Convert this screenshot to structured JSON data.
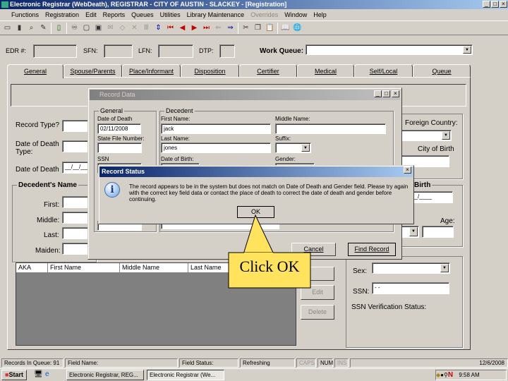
{
  "window": {
    "title": "Electronic Registrar (WebDeath), REGISTRAR - CITY OF AUSTIN - SLACKEY - [Registration]"
  },
  "menu": [
    "Functions",
    "Registration",
    "Edit",
    "Reports",
    "Queues",
    "Utilities",
    "Library Maintenance",
    "Overrides",
    "Window",
    "Help"
  ],
  "toolbar_icons": [
    "new-window-icon",
    "book-icon",
    "search-record-icon",
    "edit-icon",
    "exit-icon",
    "binoculars-icon",
    "new-document-icon",
    "save-icon",
    "stamp-icon",
    "eraser-icon",
    "delete-icon",
    "columns-icon",
    "sort-icon",
    "first-icon",
    "previous-icon",
    "next-icon",
    "last-icon",
    "back-arrow-icon",
    "forward-arrow-icon",
    "cut-icon",
    "copy-icon",
    "paste-icon",
    "help-book-icon",
    "globe-icon"
  ],
  "header": {
    "edr_label": "EDR #:",
    "sfn_label": "SFN:",
    "lfn_label": "LFN:",
    "dtp_label": "DTP:",
    "work_queue_label": "Work Queue:",
    "work_queue_value": ""
  },
  "tabs": [
    "General",
    "Spouse/Parents",
    "Place/Informant",
    "Disposition",
    "Certifier",
    "Medical",
    "Self/Local",
    "Queue"
  ],
  "general": {
    "record_type_label": "Record Type?",
    "dod_type_label": "Date of Death Type:",
    "dod_label": "Date of Death",
    "dod_value": "__/__/____",
    "decedent_name_group": "Decedent's Name",
    "first_label": "First:",
    "middle_label": "Middle:",
    "last_label": "Last:",
    "maiden_label": "Maiden:",
    "aka_columns": [
      "AKA",
      "First Name",
      "Middle Name",
      "Last Name"
    ],
    "edit_button": "Edit",
    "delete_button": "Delete",
    "foreign_country_label": "Foreign Country:",
    "city_of_birth_label": "City of Birth",
    "birth_group": "Birth",
    "dob_value": "__/__/____",
    "age_label": "Age:",
    "sex_label": "Sex:",
    "ssn_label": "SSN:",
    "ssn_value": "   -  -",
    "ssn_verification_label": "SSN Verification Status:"
  },
  "record_data": {
    "title": "Record Data",
    "general_group": "General",
    "dod_label": "Date of Death",
    "dod_value": "02/11/2008",
    "state_file_label": "State File Number:",
    "ssn_label": "SSN",
    "decedent_group": "Decedent",
    "first_name_label": "First Name:",
    "first_name_value": "jack",
    "middle_name_label": "Middle Name:",
    "last_name_label": "Last Name:",
    "last_name_value": "jones",
    "suffix_label": "Suffix:",
    "dob_label": "Date of Birth:",
    "gender_label": "Gender:",
    "cancel_button": "Cancel",
    "find_button": "Find Record"
  },
  "record_status": {
    "title": "Record Status",
    "message": "The record appears to be in the system but does not match on Date of Death and Gender field. Please try again with the correct key field data or contact the place of death to correct the date of death and gender before continuing.",
    "ok_button": "OK"
  },
  "callout": {
    "text": "Click OK",
    "color": "#ffe35c"
  },
  "statusbar": [
    "Records In Queue: 91",
    "Field Name:",
    "Field Status:",
    "Refreshing",
    "CAPS",
    "NUM",
    "INS",
    "12/6/2008"
  ],
  "taskbar": {
    "start": "Start",
    "items": [
      "Electronic Registrar, REG...",
      "Electronic Registrar (We..."
    ],
    "clock": "9:58 AM"
  }
}
